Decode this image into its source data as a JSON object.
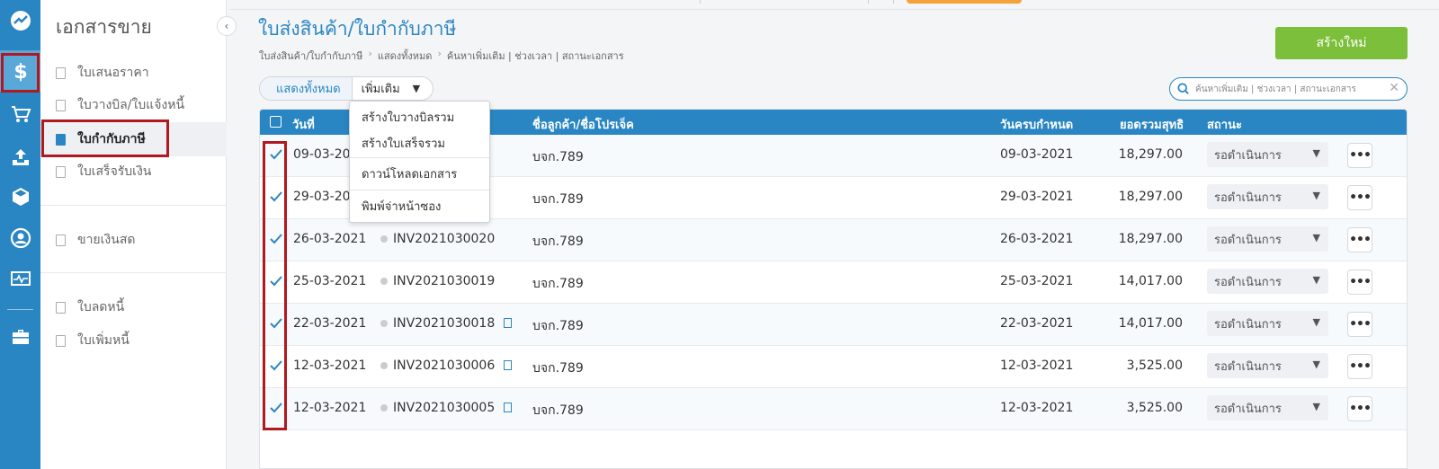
{
  "sidebar": {
    "title": "เอกสารขาย",
    "items": [
      {
        "label": "ใบเสนอราคา"
      },
      {
        "label": "ใบวางบิล/ใบแจ้งหนี้"
      },
      {
        "label": "ใบกำกับภาษี"
      },
      {
        "label": "ใบเสร็จรับเงิน"
      },
      {
        "label": "ขายเงินสด"
      },
      {
        "label": "ใบลดหนี้"
      },
      {
        "label": "ใบเพิ่มหนี้"
      }
    ]
  },
  "rail": {
    "icons": [
      "logo-icon",
      "dollar-icon",
      "cart-icon",
      "upload-tray-icon",
      "box-icon",
      "user-circle-icon",
      "monitor-chart-icon",
      "briefcase-icon"
    ]
  },
  "header": {
    "title": "ใบส่งสินค้า/ใบกำกับภาษี",
    "breadcrumb": [
      "ใบส่งสินค้า/ใบกำกับภาษี",
      "แสดงทั้งหมด",
      "ค้นหาเพิ่มเติม | ช่วงเวลา | สถานะเอกสาร"
    ],
    "create_label": "สร้างใหม่"
  },
  "filter": {
    "show_all": "แสดงทั้งหมด",
    "more": "เพิ่มเติม"
  },
  "search": {
    "placeholder": "ค้นหาเพิ่มเติม | ช่วงเวลา | สถานะเอกสาร"
  },
  "dropdown": {
    "items": [
      "สร้างใบวางบิลรวม",
      "สร้างใบเสร็จรวม",
      "ดาวน์โหลดเอกสาร",
      "พิมพ์จ่าหน้าซอง"
    ]
  },
  "table": {
    "columns": {
      "date": "วันที่",
      "customer": "ชื่อลูกค้า/ชื่อโปรเจ็ค",
      "due": "วันครบกำหนด",
      "total": "ยอดรวมสุทธิ",
      "status": "สถานะ"
    },
    "rows": [
      {
        "date": "09-03-2021",
        "doc": "",
        "customer": "บจก.789",
        "due": "09-03-2021",
        "total": "18,297.00",
        "status": "รอดำเนินการ"
      },
      {
        "date": "29-03-2021",
        "doc": "",
        "customer": "บจก.789",
        "due": "29-03-2021",
        "total": "18,297.00",
        "status": "รอดำเนินการ"
      },
      {
        "date": "26-03-2021",
        "doc": "INV2021030020",
        "customer": "บจก.789",
        "due": "26-03-2021",
        "total": "18,297.00",
        "status": "รอดำเนินการ"
      },
      {
        "date": "25-03-2021",
        "doc": "INV2021030019",
        "customer": "บจก.789",
        "due": "25-03-2021",
        "total": "14,017.00",
        "status": "รอดำเนินการ"
      },
      {
        "date": "22-03-2021",
        "doc": "INV2021030018",
        "customer": "บจก.789",
        "due": "22-03-2021",
        "total": "14,017.00",
        "status": "รอดำเนินการ"
      },
      {
        "date": "12-03-2021",
        "doc": "INV2021030006",
        "customer": "บจก.789",
        "due": "12-03-2021",
        "total": "3,525.00",
        "status": "รอดำเนินการ"
      },
      {
        "date": "12-03-2021",
        "doc": "INV2021030005",
        "customer": "บจก.789",
        "due": "12-03-2021",
        "total": "3,525.00",
        "status": "รอดำเนินการ"
      }
    ]
  },
  "colors": {
    "primary": "#2a86c3",
    "create_button": "#7cbf3a",
    "highlight_box": "#b0191f"
  }
}
